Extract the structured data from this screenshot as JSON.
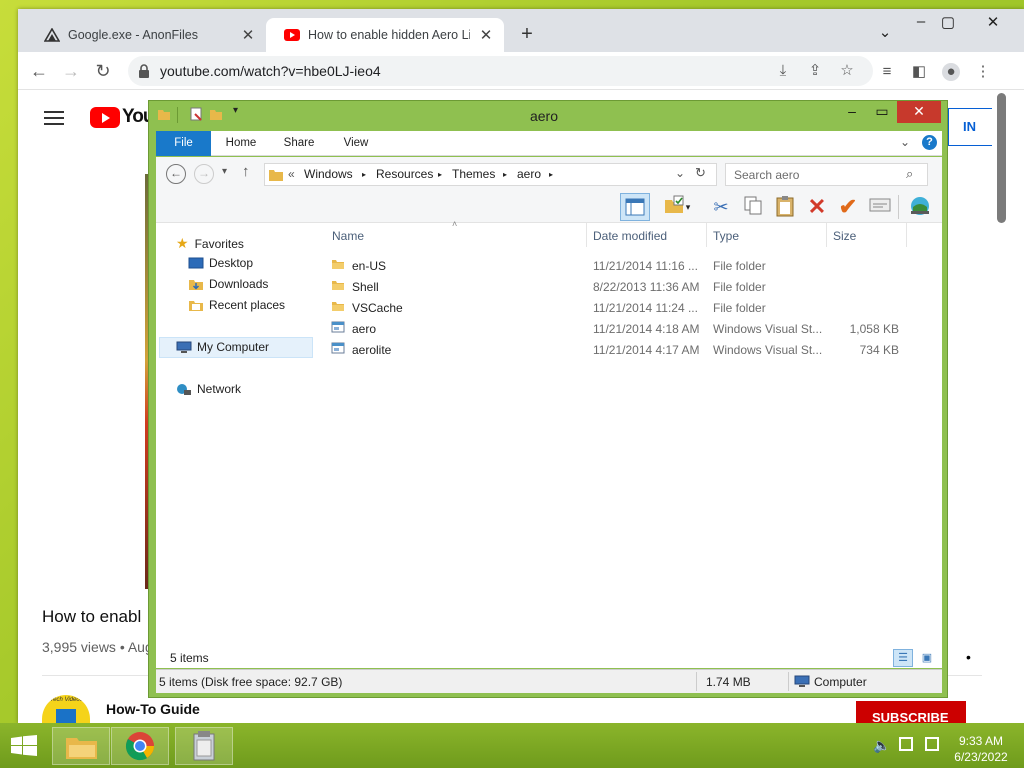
{
  "desktop": {
    "background": "#a6c92b"
  },
  "browser": {
    "tabs": [
      {
        "title": "Google.exe - AnonFiles",
        "icon": "anonfiles-icon"
      },
      {
        "title": "How to enable hidden Aero Lite",
        "icon": "youtube-icon"
      }
    ],
    "address": "youtube.com/watch?v=hbe0LJ-ieo4"
  },
  "youtube": {
    "logo_text": "You",
    "signin": "IN",
    "video_title": "How to enabl",
    "views": "3,995 views • Aug",
    "channel": "How-To Guide",
    "subscribe": "SUBSCRIBE",
    "avatar_text": "Tech Videos"
  },
  "explorer": {
    "title": "aero",
    "ribbon_tabs": [
      "File",
      "Home",
      "Share",
      "View"
    ],
    "breadcrumb": [
      "«",
      "Windows",
      "Resources",
      "Themes",
      "aero"
    ],
    "search_placeholder": "Search aero",
    "nav": {
      "favorites": "Favorites",
      "desktop": "Desktop",
      "downloads": "Downloads",
      "recent": "Recent places",
      "computer": "My Computer",
      "network": "Network"
    },
    "columns": {
      "name": "Name",
      "date": "Date modified",
      "type": "Type",
      "size": "Size"
    },
    "files": [
      {
        "name": "en-US",
        "date": "11/21/2014 11:16 ...",
        "type": "File folder",
        "size": "",
        "kind": "folder"
      },
      {
        "name": "Shell",
        "date": "8/22/2013 11:36 AM",
        "type": "File folder",
        "size": "",
        "kind": "folder"
      },
      {
        "name": "VSCache",
        "date": "11/21/2014 11:24 ...",
        "type": "File folder",
        "size": "",
        "kind": "folder"
      },
      {
        "name": "aero",
        "date": "11/21/2014 4:18 AM",
        "type": "Windows Visual St...",
        "size": "1,058 KB",
        "kind": "style"
      },
      {
        "name": "aerolite",
        "date": "11/21/2014 4:17 AM",
        "type": "Windows Visual St...",
        "size": "734 KB",
        "kind": "style"
      }
    ],
    "item_count": "5 items",
    "status": {
      "left": "5 items (Disk free space: 92.7 GB)",
      "size": "1.74 MB",
      "location": "Computer"
    }
  },
  "taskbar": {
    "time": "9:33 AM",
    "date": "6/23/2022"
  }
}
